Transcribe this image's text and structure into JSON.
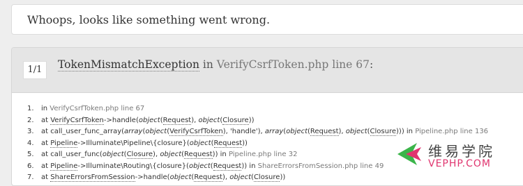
{
  "header": {
    "message": "Whoops, looks like something went wrong."
  },
  "exception": {
    "counter": "1/1",
    "class": "TokenMismatchException",
    "in_word": "in",
    "file": "VerifyCsrfToken.php line 67",
    "colon": ":"
  },
  "trace": [
    {
      "num": "1.",
      "segments": [
        {
          "t": "in "
        },
        {
          "t": "VerifyCsrfToken.php line 67",
          "c": "file"
        }
      ]
    },
    {
      "num": "2.",
      "segments": [
        {
          "t": "at "
        },
        {
          "t": "VerifyCsrfToken",
          "c": "abbr"
        },
        {
          "t": "->handle("
        },
        {
          "t": "object",
          "c": "em"
        },
        {
          "t": "("
        },
        {
          "t": "Request",
          "c": "abbr"
        },
        {
          "t": "), "
        },
        {
          "t": "object",
          "c": "em"
        },
        {
          "t": "("
        },
        {
          "t": "Closure",
          "c": "abbr"
        },
        {
          "t": "))"
        }
      ]
    },
    {
      "num": "3.",
      "segments": [
        {
          "t": "at call_user_func_array("
        },
        {
          "t": "array",
          "c": "em"
        },
        {
          "t": "("
        },
        {
          "t": "object",
          "c": "em"
        },
        {
          "t": "("
        },
        {
          "t": "VerifyCsrfToken",
          "c": "abbr"
        },
        {
          "t": "), 'handle'), "
        },
        {
          "t": "array",
          "c": "em"
        },
        {
          "t": "("
        },
        {
          "t": "object",
          "c": "em"
        },
        {
          "t": "("
        },
        {
          "t": "Request",
          "c": "abbr"
        },
        {
          "t": "), "
        },
        {
          "t": "object",
          "c": "em"
        },
        {
          "t": "("
        },
        {
          "t": "Closure",
          "c": "abbr"
        },
        {
          "t": "))) in "
        },
        {
          "t": "Pipeline.php line 136",
          "c": "file"
        }
      ]
    },
    {
      "num": "4.",
      "segments": [
        {
          "t": "at "
        },
        {
          "t": "Pipeline",
          "c": "abbr"
        },
        {
          "t": "->Illuminate\\Pipeline\\{closure}("
        },
        {
          "t": "object",
          "c": "em"
        },
        {
          "t": "("
        },
        {
          "t": "Request",
          "c": "abbr"
        },
        {
          "t": "))"
        }
      ]
    },
    {
      "num": "5.",
      "segments": [
        {
          "t": "at call_user_func("
        },
        {
          "t": "object",
          "c": "em"
        },
        {
          "t": "("
        },
        {
          "t": "Closure",
          "c": "abbr"
        },
        {
          "t": "), "
        },
        {
          "t": "object",
          "c": "em"
        },
        {
          "t": "("
        },
        {
          "t": "Request",
          "c": "abbr"
        },
        {
          "t": ")) in "
        },
        {
          "t": "Pipeline.php line 32",
          "c": "file"
        }
      ]
    },
    {
      "num": "6.",
      "segments": [
        {
          "t": "at "
        },
        {
          "t": "Pipeline",
          "c": "abbr"
        },
        {
          "t": "->Illuminate\\Routing\\{closure}("
        },
        {
          "t": "object",
          "c": "em"
        },
        {
          "t": "("
        },
        {
          "t": "Request",
          "c": "abbr"
        },
        {
          "t": ")) in "
        },
        {
          "t": "ShareErrorsFromSession.php line 49",
          "c": "file"
        }
      ]
    },
    {
      "num": "7.",
      "segments": [
        {
          "t": "at "
        },
        {
          "t": "ShareErrorsFromSession",
          "c": "abbr"
        },
        {
          "t": "->handle("
        },
        {
          "t": "object",
          "c": "em"
        },
        {
          "t": "("
        },
        {
          "t": "Request",
          "c": "abbr"
        },
        {
          "t": "), "
        },
        {
          "t": "object",
          "c": "em"
        },
        {
          "t": "("
        },
        {
          "t": "Closure",
          "c": "abbr"
        },
        {
          "t": "))"
        }
      ]
    }
  ],
  "watermark": {
    "chinese": "维易学院",
    "english": "VEPHP.COM",
    "colors": {
      "green": "#3bb54a",
      "pink": "#e0356f"
    }
  }
}
